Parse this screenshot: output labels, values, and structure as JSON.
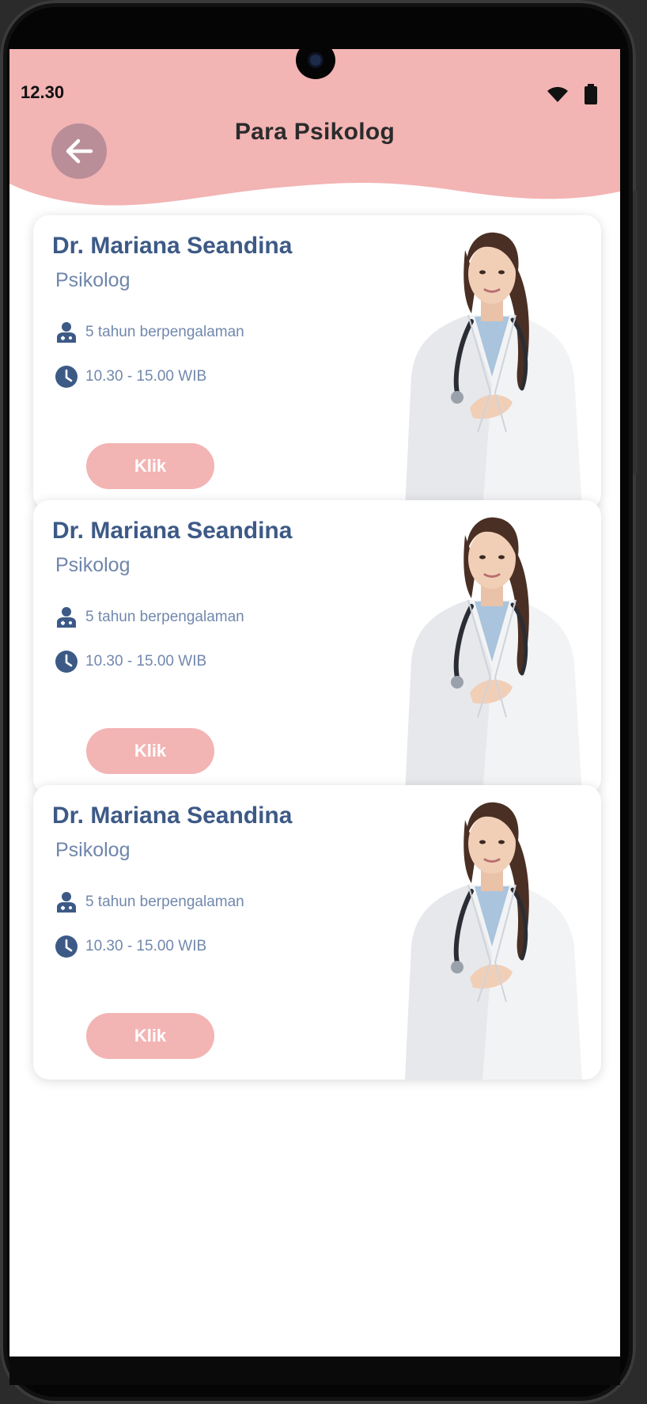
{
  "status_bar": {
    "time": "12.30",
    "wifi_icon": "wifi-icon",
    "battery_icon": "battery-icon"
  },
  "header": {
    "title": "Para Psikolog",
    "back_icon": "arrow-left-icon",
    "color": "#f3b4b4"
  },
  "colors": {
    "accent": "#f3b4b4",
    "name": "#3d5a86",
    "muted": "#7188ad"
  },
  "doctors": [
    {
      "name": "Dr. Mariana Seandina",
      "role": "Psikolog",
      "experience": "5 tahun berpengalaman",
      "hours": "10.30 - 15.00 WIB",
      "button": "Klik"
    },
    {
      "name": "Dr. Mariana Seandina",
      "role": "Psikolog",
      "experience": "5 tahun berpengalaman",
      "hours": "10.30 - 15.00 WIB",
      "button": "Klik"
    },
    {
      "name": "Dr. Mariana Seandina",
      "role": "Psikolog",
      "experience": "5 tahun berpengalaman",
      "hours": "10.30 - 15.00 WIB",
      "button": "Klik"
    }
  ]
}
